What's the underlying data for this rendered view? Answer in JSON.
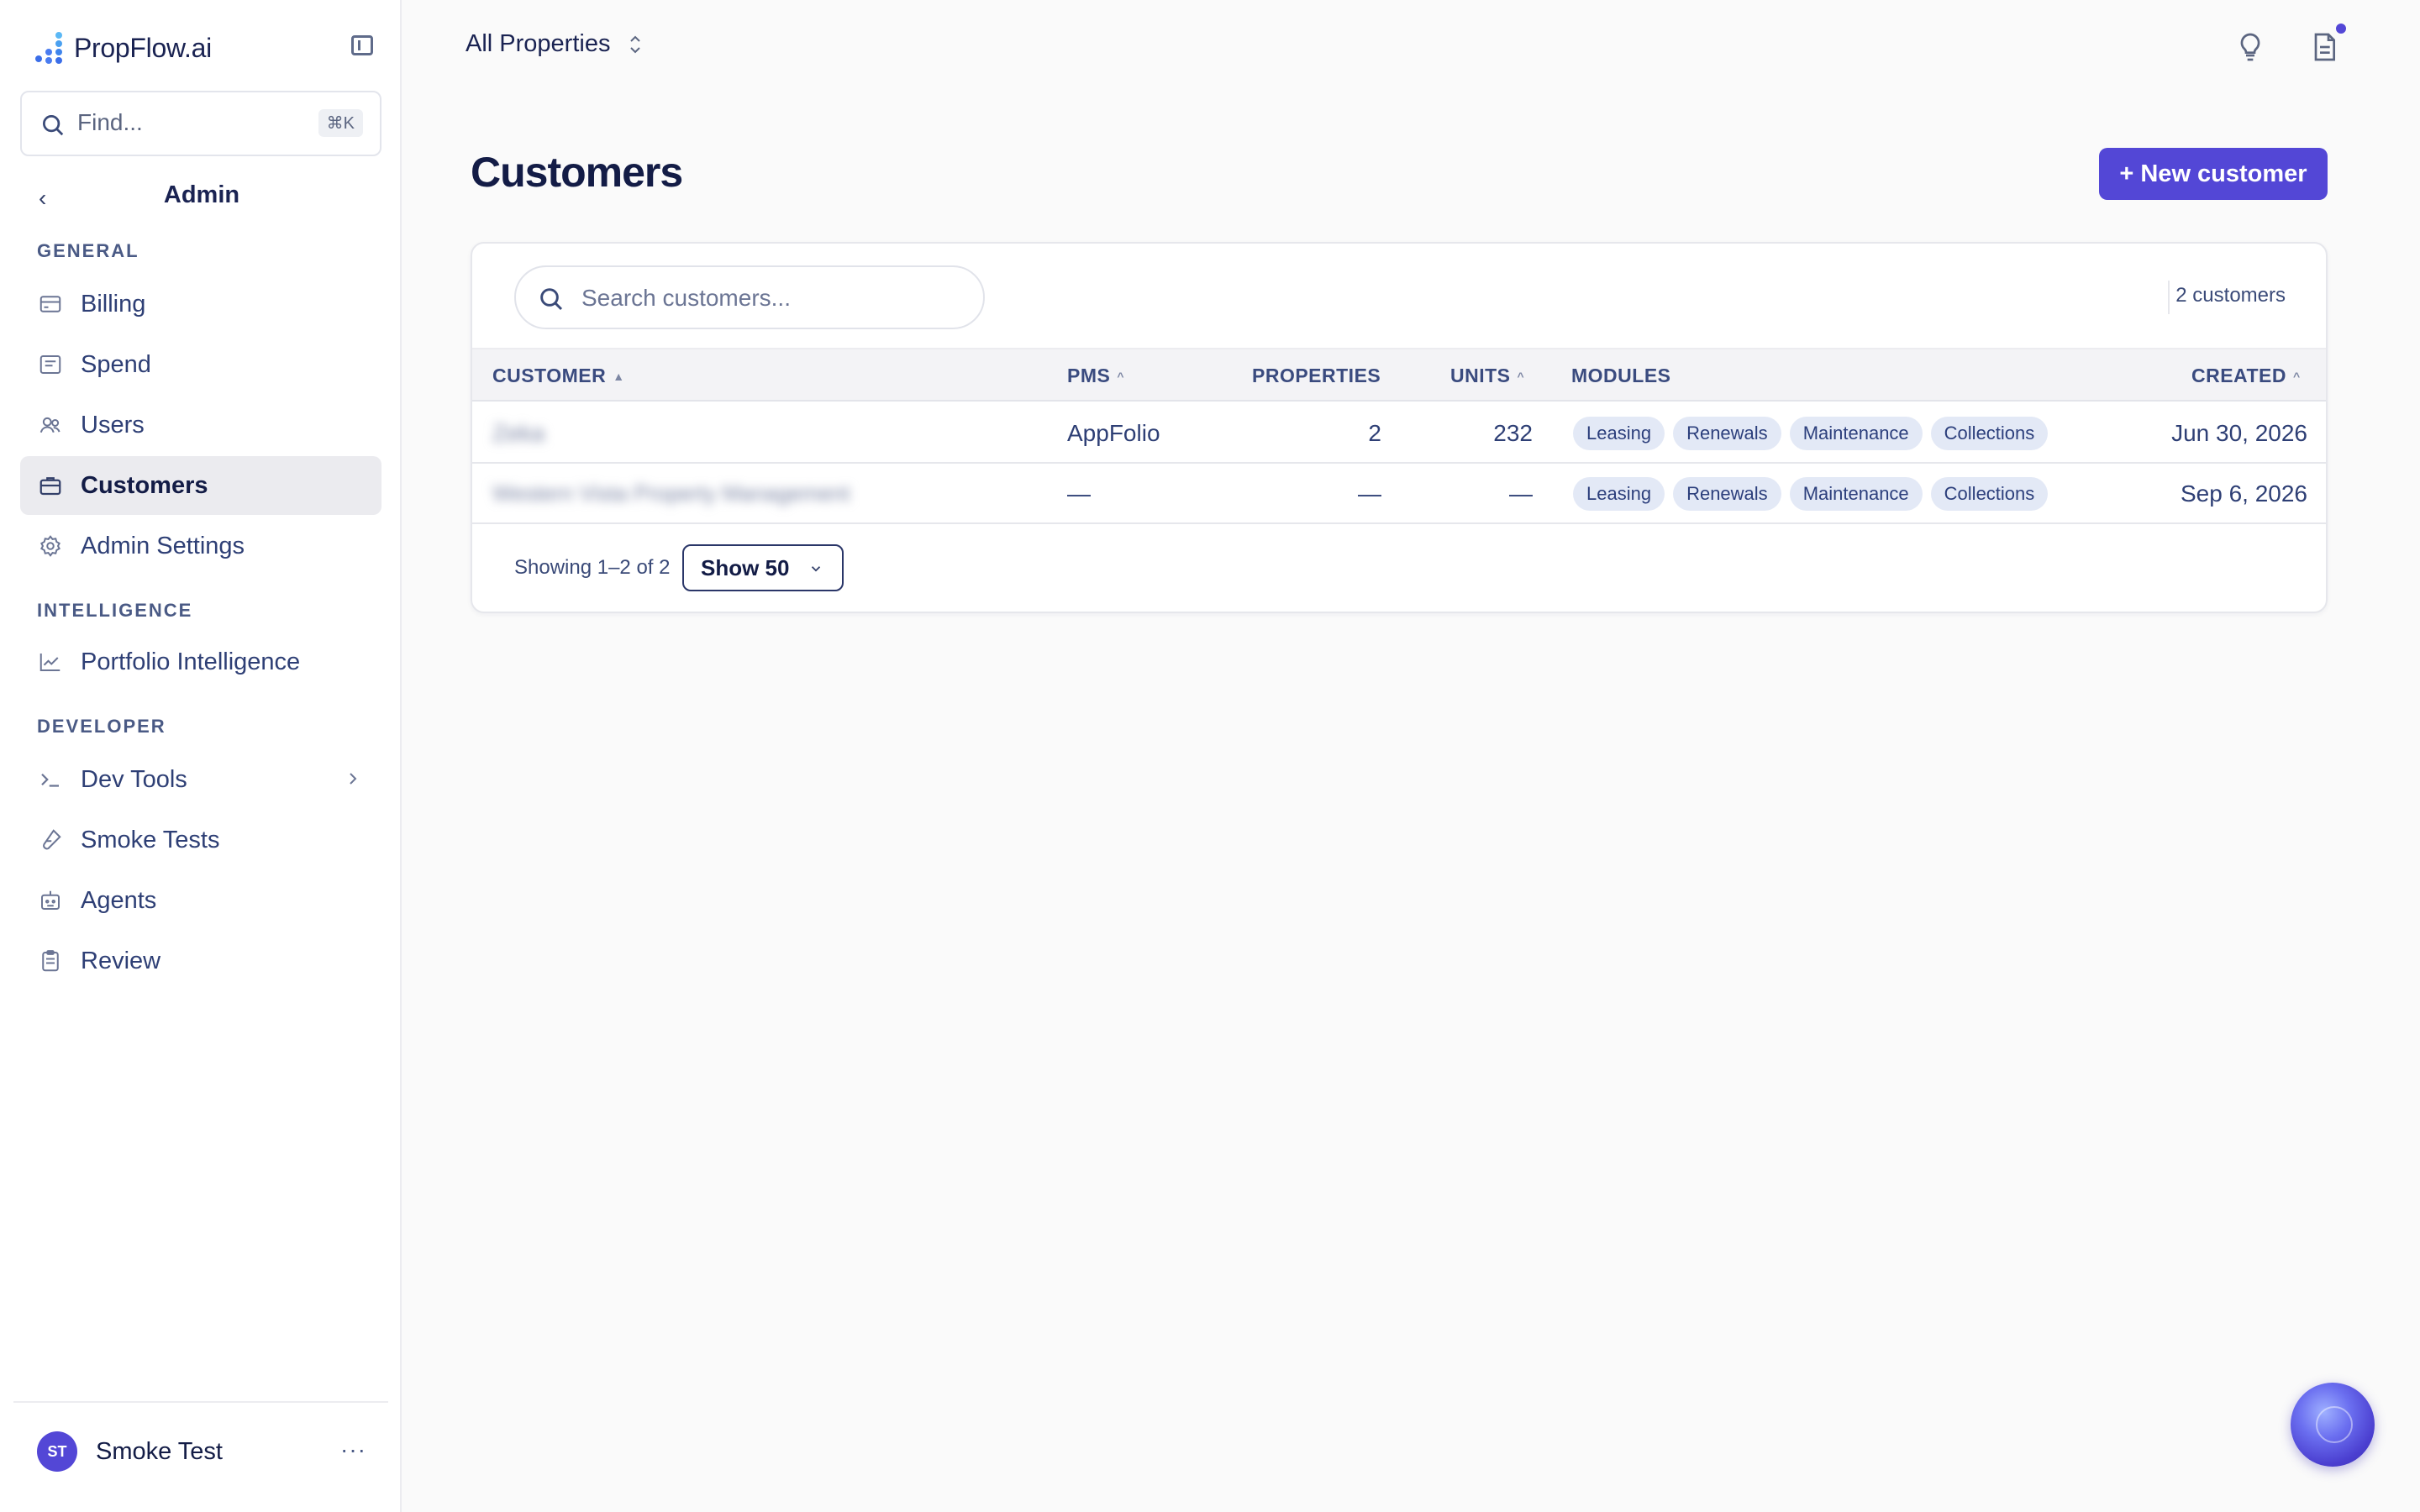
{
  "brand": {
    "name": "PropFlow.ai"
  },
  "sidebar": {
    "find_placeholder": "Find...",
    "find_shortcut": "⌘K",
    "section_title": "Admin",
    "groups": [
      {
        "label": "GENERAL"
      },
      {
        "label": "INTELLIGENCE"
      },
      {
        "label": "DEVELOPER"
      }
    ],
    "items": [
      {
        "label": "Billing",
        "icon": "credit-card-icon"
      },
      {
        "label": "Spend",
        "icon": "receipt-icon"
      },
      {
        "label": "Users",
        "icon": "users-icon"
      },
      {
        "label": "Customers",
        "icon": "briefcase-icon",
        "active": true
      },
      {
        "label": "Admin Settings",
        "icon": "gear-icon"
      },
      {
        "label": "Portfolio Intelligence",
        "icon": "chart-line-icon"
      },
      {
        "label": "Dev Tools",
        "icon": "terminal-icon"
      },
      {
        "label": "Smoke Tests",
        "icon": "test-tube-icon"
      },
      {
        "label": "Agents",
        "icon": "bot-icon"
      },
      {
        "label": "Review",
        "icon": "clipboard-icon"
      }
    ],
    "user": {
      "initials": "ST",
      "name": "Smoke Test",
      "more": "···"
    }
  },
  "topbar": {
    "property_selector": "All Properties"
  },
  "page": {
    "title": "Customers",
    "new_button": "+ New customer",
    "search_placeholder": "Search customers...",
    "count_text": "2 customers"
  },
  "table": {
    "columns": [
      "CUSTOMER",
      "PMS",
      "PROPERTIES",
      "UNITS",
      "MODULES",
      "CREATED"
    ],
    "rows": [
      {
        "customer": "Zeka",
        "pms": "AppFolio",
        "properties": "2",
        "units": "232",
        "modules": [
          "Leasing",
          "Renewals",
          "Maintenance",
          "Collections"
        ],
        "created": "Jun 30, 2026"
      },
      {
        "customer": "Western Vista Property Management",
        "pms": "—",
        "properties": "—",
        "units": "—",
        "modules": [
          "Leasing",
          "Renewals",
          "Maintenance",
          "Collections"
        ],
        "created": "Sep 6, 2026"
      }
    ],
    "footer_text": "Showing 1–2 of 2",
    "page_size": "Show 50"
  },
  "colors": {
    "accent": "#5347d6",
    "tag_bg": "#e3e9f6",
    "text": "#1f2a5a"
  }
}
